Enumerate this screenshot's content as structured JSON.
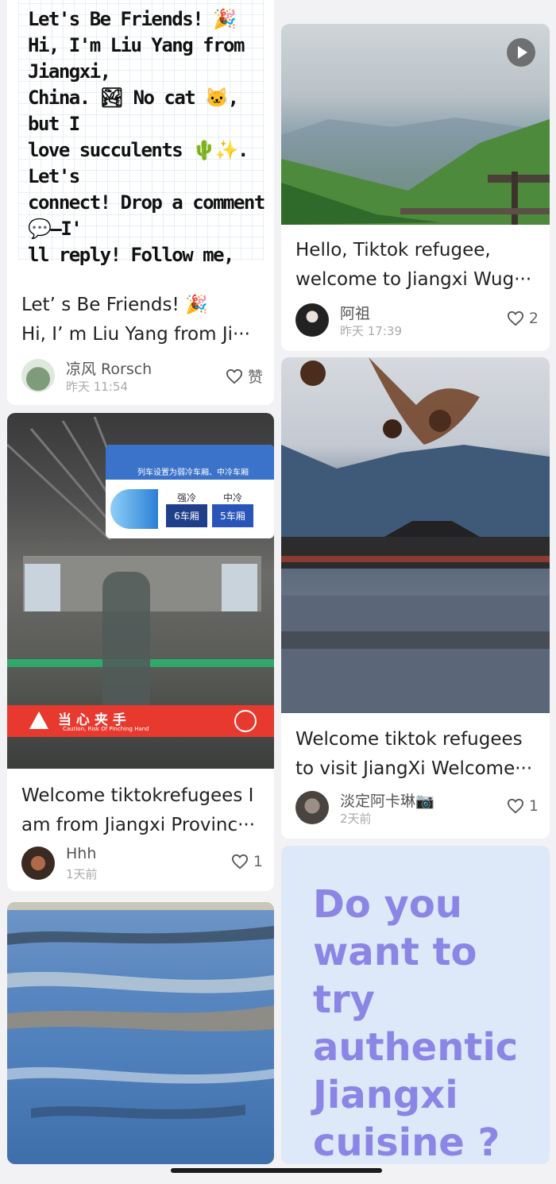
{
  "posts": [
    {
      "image_text": "Let's Be Friends! 🎉\nHi, I'm Liu Yang from Jiangxi,\nChina. 🏞 No cat 🐱, but I\nlove succulents 🌵✨. Let's\nconnect! Drop a comment 💬—I'\nll reply! Follow me, and I'll\nfollow back. 🎉",
      "title": "Let’ s Be Friends! 🎉\nHi, I’ m Liu Yang from Ji···",
      "author": "凉风 Rorsch",
      "time": "昨天 11:54",
      "likes": "赞"
    },
    {
      "title": "Hello, Tiktok refugee,\nwelcome to Jiangxi Wug···",
      "author": "阿祖",
      "time": "昨天 17:39",
      "likes": "2"
    },
    {
      "sign_text": "列车设置为弱冷车厢、中冷车厢",
      "sign_labels": [
        "强冷",
        "中冷"
      ],
      "sign_cars": [
        "6车厢",
        "5车厢"
      ],
      "warning_text": "当 心 夹 手",
      "warning_en": "Caution, Risk Of Pinching Hand",
      "title": "Welcome tiktokrefugees I\nam from Jiangxi Provinc···",
      "author": "Hhh",
      "time": "1天前",
      "likes": "1"
    },
    {
      "title": "Welcome tiktok refugees\nto visit JiangXi Welcome···",
      "author": "淡定阿卡琳📷",
      "time": "2天前",
      "likes": "1"
    },
    {
      "image_text": "Do you\nwant to\ntry\nauthentic\nJiangxi\ncuisine ? 😱"
    }
  ],
  "colors": {
    "background": "#f2f2f4",
    "card": "#ffffff",
    "purple_text": "#8b86e6",
    "purple_bg": "#dde8f8"
  }
}
